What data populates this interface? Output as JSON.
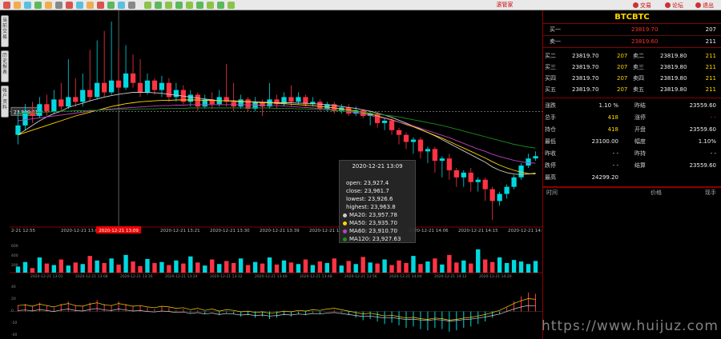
{
  "toolbar": {
    "title": "滚管家",
    "icons": [
      "home-icon",
      "search-icon",
      "refresh-icon",
      "bar-chart-icon",
      "candle-chart-icon",
      "calendar-icon",
      "zoom-in-icon",
      "zoom-out-icon",
      "settings-icon",
      "filter-icon",
      "grid-icon",
      "line-icon",
      "window-icon"
    ],
    "buttons": [
      {
        "label": "交易"
      },
      {
        "label": "论坛"
      },
      {
        "label": "退出"
      }
    ]
  },
  "side_tabs": [
    {
      "label": "当前交易"
    },
    {
      "label": "历史报表"
    },
    {
      "label": "帐户资料"
    }
  ],
  "chart": {
    "price_marker": "23,929.61",
    "time_labels": [
      "2-21 12:55",
      "2020-12-21 13:0",
      "13:12",
      "2020-12-21 13:21",
      "2020-12-21 13:30",
      "2020-12-21 13:39",
      "2020-12-21 13:48",
      "2020-12-21 13:57",
      "2020-12-21 14:06",
      "2020-12-21 14:15",
      "2020-12-21 14:24"
    ],
    "highlight_time": "2020-12-21 13:09",
    "vol_axis": [
      "600",
      "400",
      "200"
    ],
    "vol_time_labels": [
      "2020-12-21 13:01",
      "2020-12-21 13:08",
      "2020-12-21 13:16",
      "2020-12-21 13:24",
      "2020-12-21 13:32",
      "2020-12-21 13:40",
      "2020-12-21 13:48",
      "2020-12-21 13:56",
      "2020-12-21 14:04",
      "2020-12-21 14:12",
      "2020-12-21 14:20"
    ],
    "macd_axis": [
      "40",
      "20",
      "0",
      "-20",
      "-40"
    ]
  },
  "chart_data": {
    "type": "candlestick",
    "candles": [
      [
        23880,
        23900,
        23860,
        23930
      ],
      [
        23900,
        23930,
        23890,
        23945
      ],
      [
        23930,
        23920,
        23905,
        23950
      ],
      [
        23920,
        23945,
        23915,
        23960
      ],
      [
        23945,
        23930,
        23920,
        23965
      ],
      [
        23930,
        23955,
        23925,
        23975
      ],
      [
        23955,
        23940,
        23930,
        23990
      ],
      [
        23940,
        23960,
        23935,
        24040
      ],
      [
        23960,
        23950,
        23940,
        24000
      ],
      [
        23950,
        23975,
        23940,
        24010
      ],
      [
        23975,
        23960,
        23950,
        24060
      ],
      [
        23960,
        23990,
        23955,
        24080
      ],
      [
        23990,
        23970,
        23960,
        24100
      ],
      [
        23970,
        23995,
        23965,
        24120
      ],
      [
        23995,
        23980,
        23970,
        24060
      ],
      [
        23980,
        24010,
        23975,
        24070
      ],
      [
        24010,
        23990,
        23980,
        24050
      ],
      [
        23990,
        23970,
        23960,
        24040
      ],
      [
        23970,
        23995,
        23965,
        24010
      ],
      [
        23995,
        23975,
        23965,
        24000
      ],
      [
        23975,
        23990,
        23960,
        24005
      ],
      [
        23990,
        23960,
        23950,
        24000
      ],
      [
        23960,
        23975,
        23950,
        23990
      ],
      [
        23975,
        23950,
        23945,
        23985
      ],
      [
        23950,
        23965,
        23940,
        23975
      ],
      [
        23965,
        23940,
        23930,
        23970
      ],
      [
        23940,
        23955,
        23935,
        23965
      ],
      [
        23955,
        23945,
        23935,
        23970
      ],
      [
        23945,
        23960,
        23940,
        23975
      ],
      [
        23960,
        23950,
        23940,
        24030
      ],
      [
        23950,
        23940,
        23930,
        23990
      ],
      [
        23940,
        23955,
        23935,
        23965
      ],
      [
        23955,
        23935,
        23930,
        23960
      ],
      [
        23935,
        23950,
        23930,
        23960
      ],
      [
        23950,
        23940,
        23920,
        23955
      ],
      [
        23940,
        23955,
        23935,
        23990
      ],
      [
        23955,
        23945,
        23935,
        23965
      ],
      [
        23945,
        23960,
        23940,
        23970
      ],
      [
        23960,
        23950,
        23940,
        23985
      ],
      [
        23950,
        23960,
        23945,
        23970
      ],
      [
        23960,
        23945,
        23940,
        23965
      ],
      [
        23945,
        23950,
        23940,
        23960
      ],
      [
        23950,
        23935,
        23930,
        23955
      ],
      [
        23935,
        23945,
        23930,
        23950
      ],
      [
        23945,
        23930,
        23925,
        23950
      ],
      [
        23930,
        23938,
        23925,
        23945
      ],
      [
        23938,
        23925,
        23920,
        23945
      ],
      [
        23925,
        23932,
        23920,
        23940
      ],
      [
        23932,
        23920,
        23915,
        23935
      ],
      [
        23920,
        23925,
        23900,
        23930
      ],
      [
        23925,
        23905,
        23895,
        23930
      ],
      [
        23905,
        23910,
        23890,
        23915
      ],
      [
        23910,
        23890,
        23880,
        23915
      ],
      [
        23890,
        23880,
        23860,
        23895
      ],
      [
        23880,
        23865,
        23850,
        23885
      ],
      [
        23865,
        23870,
        23840,
        23875
      ],
      [
        23870,
        23845,
        23830,
        23875
      ],
      [
        23845,
        23850,
        23820,
        23855
      ],
      [
        23850,
        23825,
        23800,
        23855
      ],
      [
        23825,
        23830,
        23790,
        23835
      ],
      [
        23830,
        23805,
        23785,
        23840
      ],
      [
        23805,
        23790,
        23770,
        23810
      ],
      [
        23790,
        23800,
        23770,
        23805
      ],
      [
        23800,
        23780,
        23760,
        23810
      ],
      [
        23780,
        23785,
        23760,
        23790
      ],
      [
        23785,
        23765,
        23740,
        23790
      ],
      [
        23765,
        23740,
        23700,
        23770
      ],
      [
        23740,
        23755,
        23730,
        23760
      ],
      [
        23755,
        23770,
        23745,
        23775
      ],
      [
        23770,
        23790,
        23765,
        23795
      ],
      [
        23790,
        23815,
        23785,
        23820
      ],
      [
        23815,
        23830,
        23810,
        23840
      ],
      [
        23830,
        23835,
        23825,
        23845
      ]
    ],
    "ma_series": [
      {
        "name": "MA20",
        "color": "#cccccc",
        "values": [
          23880,
          23890,
          23900,
          23910,
          23918,
          23925,
          23930,
          23938,
          23943,
          23947,
          23952,
          23956,
          23960,
          23963,
          23966,
          23968,
          23970,
          23970,
          23970,
          23969,
          23968,
          23966,
          23964,
          23962,
          23960,
          23958,
          23956,
          23954,
          23952,
          23952,
          23952,
          23951,
          23950,
          23950,
          23949,
          23949,
          23948,
          23948,
          23948,
          23947,
          23947,
          23946,
          23945,
          23944,
          23942,
          23940,
          23938,
          23936,
          23933,
          23930,
          23926,
          23922,
          23917,
          23911,
          23905,
          23899,
          23892,
          23885,
          23878,
          23870,
          23862,
          23854,
          23846,
          23838,
          23830,
          23822,
          23812,
          23805,
          23800,
          23797,
          23796,
          23797,
          23799
        ]
      },
      {
        "name": "MA50",
        "color": "#ffd700",
        "values": [
          23880,
          23885,
          23890,
          23895,
          23900,
          23905,
          23910,
          23915,
          23920,
          23924,
          23928,
          23932,
          23936,
          23940,
          23943,
          23946,
          23948,
          23950,
          23951,
          23952,
          23953,
          23953,
          23954,
          23954,
          23954,
          23954,
          23953,
          23953,
          23952,
          23952,
          23951,
          23950,
          23950,
          23949,
          23948,
          23948,
          23947,
          23946,
          23945,
          23944,
          23943,
          23942,
          23940,
          23939,
          23937,
          23935,
          23933,
          23930,
          23927,
          23924,
          23920,
          23916,
          23912,
          23907,
          23902,
          23897,
          23891,
          23885,
          23879,
          23873,
          23866,
          23859,
          23852,
          23845,
          23838,
          23831,
          23823,
          23816,
          23810,
          23805,
          23801,
          23798,
          23797
        ]
      },
      {
        "name": "MA60",
        "color": "#c040c0",
        "values": [
          23910,
          23912,
          23914,
          23916,
          23918,
          23920,
          23922,
          23924,
          23926,
          23928,
          23930,
          23932,
          23934,
          23935,
          23936,
          23937,
          23938,
          23939,
          23940,
          23941,
          23942,
          23942,
          23943,
          23943,
          23944,
          23944,
          23944,
          23944,
          23944,
          23944,
          23944,
          23944,
          23944,
          23943,
          23943,
          23942,
          23942,
          23941,
          23940,
          23939,
          23938,
          23937,
          23936,
          23935,
          23933,
          23931,
          23929,
          23927,
          23924,
          23921,
          23918,
          23915,
          23911,
          23907,
          23903,
          23899,
          23894,
          23889,
          23884,
          23879,
          23874,
          23868,
          23862,
          23856,
          23850,
          23845,
          23839,
          23834,
          23830,
          23826,
          23823,
          23821,
          23820
        ]
      },
      {
        "name": "MA120",
        "color": "#1e8c1e",
        "values": [
          23925,
          23926,
          23927,
          23928,
          23928,
          23929,
          23930,
          23930,
          23931,
          23931,
          23932,
          23932,
          23933,
          23933,
          23934,
          23934,
          23934,
          23935,
          23935,
          23935,
          23936,
          23936,
          23936,
          23936,
          23937,
          23937,
          23937,
          23937,
          23937,
          23937,
          23937,
          23937,
          23937,
          23937,
          23937,
          23937,
          23936,
          23936,
          23936,
          23935,
          23935,
          23934,
          23934,
          23933,
          23932,
          23931,
          23930,
          23929,
          23928,
          23926,
          23924,
          23922,
          23920,
          23918,
          23915,
          23912,
          23909,
          23906,
          23903,
          23900,
          23896,
          23892,
          23888,
          23884,
          23880,
          23876,
          23872,
          23868,
          23864,
          23860,
          23857,
          23854,
          23852
        ]
      }
    ],
    "volume": [
      120,
      210,
      90,
      300,
      180,
      150,
      260,
      140,
      200,
      170,
      330,
      240,
      190,
      280,
      160,
      350,
      220,
      130,
      270,
      190,
      210,
      150,
      240,
      180,
      320,
      200,
      140,
      260,
      170,
      230,
      190,
      280,
      150,
      210,
      180,
      300,
      160,
      240,
      200,
      170,
      260,
      150,
      220,
      190,
      280,
      140,
      230,
      170,
      310,
      200,
      180,
      260,
      150,
      240,
      190,
      330,
      170,
      220,
      280,
      160,
      350,
      200,
      240,
      180,
      460,
      260,
      210,
      300,
      190,
      250,
      220,
      170,
      230
    ],
    "macd": [
      10,
      12,
      8,
      14,
      10,
      6,
      12,
      16,
      10,
      8,
      14,
      18,
      12,
      10,
      16,
      12,
      8,
      10,
      6,
      4,
      8,
      6,
      2,
      4,
      -2,
      2,
      -4,
      0,
      -6,
      -2,
      -4,
      -8,
      -6,
      -10,
      -8,
      -12,
      -10,
      -6,
      -8,
      -4,
      -6,
      -2,
      -4,
      0,
      2,
      -2,
      -6,
      -10,
      -14,
      -12,
      -16,
      -20,
      -18,
      -22,
      -26,
      -24,
      -28,
      -30,
      -26,
      -28,
      -32,
      -30,
      -26,
      -24,
      -20,
      -16,
      -10,
      -4,
      6,
      16,
      24,
      30,
      28
    ],
    "ylim": [
      23700,
      24130
    ]
  },
  "tooltip": {
    "title": "2020-12-21 13:09",
    "open": "open: 23,927.4",
    "close": "close: 23,961.7",
    "lowest": "lowest: 23,926.6",
    "highest": "highest: 23,963.8",
    "ma20": "MA20: 23,957.78",
    "ma50": "MA50: 23,935.70",
    "ma60": "MA60: 23,910.70",
    "ma120": "MA120: 23,927.63"
  },
  "panel": {
    "symbol": "BTCBTC",
    "buy1": {
      "label": "买一",
      "price": "23819.70",
      "qty": "207"
    },
    "sell1": {
      "label": "卖一",
      "price": "23819.60",
      "qty": "211"
    },
    "depth": [
      {
        "bl": "买二",
        "bp": "23819.70",
        "bq": "207",
        "sl": "卖二",
        "sp": "23819.80",
        "sq": "211"
      },
      {
        "bl": "买三",
        "bp": "23819.70",
        "bq": "207",
        "sl": "卖三",
        "sp": "23819.80",
        "sq": "211"
      },
      {
        "bl": "买四",
        "bp": "23819.70",
        "bq": "207",
        "sl": "卖四",
        "sp": "23819.80",
        "sq": "211"
      },
      {
        "bl": "买五",
        "bp": "23819.70",
        "bq": "207",
        "sl": "卖五",
        "sp": "23819.80",
        "sq": "211"
      }
    ],
    "stats": [
      {
        "l1": "涨跌",
        "v1": "1.10 %",
        "l2": "昨结",
        "v2": "23559.60",
        "c1": "white",
        "c2": "white"
      },
      {
        "l1": "总手",
        "v1": "418",
        "l2": "涨停",
        "v2": "- -",
        "c1": "yellow",
        "c2": "red"
      },
      {
        "l1": "持仓",
        "v1": "418",
        "l2": "开盘",
        "v2": "23559.60",
        "c1": "yellow",
        "c2": "white"
      },
      {
        "l1": "最低",
        "v1": "23100.00",
        "l2": "幅度",
        "v2": "1.10%",
        "c1": "white",
        "c2": "white"
      },
      {
        "l1": "昨收",
        "v1": "- -",
        "l2": "昨持",
        "v2": "- -",
        "c1": "white",
        "c2": "white"
      },
      {
        "l1": "跌停",
        "v1": "- -",
        "l2": "结算",
        "v2": "23559.60",
        "c1": "white",
        "c2": "white"
      },
      {
        "l1": "最高",
        "v1": "24299.20",
        "l2": "",
        "v2": "",
        "c1": "white",
        "c2": "white"
      }
    ],
    "trade_head": {
      "time": "时间",
      "price": "价格",
      "qty": "现手"
    }
  },
  "watermark": "https://www.huijuz.com"
}
